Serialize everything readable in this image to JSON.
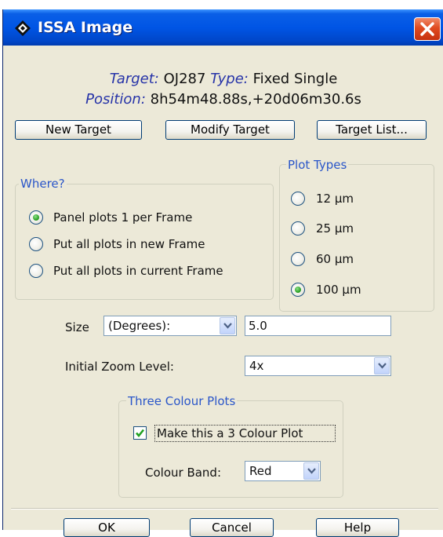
{
  "window": {
    "title": "ISSA Image",
    "icon": "diamond-app-icon",
    "close_icon": "close-icon"
  },
  "target": {
    "target_label": "Target:",
    "target_value": "OJ287",
    "type_label": "Type:",
    "type_value": "Fixed Single",
    "position_label": "Position:",
    "position_value": "8h54m48.88s,+20d06m30.6s"
  },
  "buttons": {
    "new_target": "New Target",
    "modify_target": "Modify Target",
    "target_list": "Target List...",
    "ok": "OK",
    "cancel": "Cancel",
    "help": "Help"
  },
  "where": {
    "title": "Where?",
    "options": [
      {
        "label": "Panel plots 1 per Frame",
        "selected": true
      },
      {
        "label": "Put all plots in new Frame",
        "selected": false
      },
      {
        "label": "Put all plots in current Frame",
        "selected": false
      }
    ]
  },
  "plot_types": {
    "title": "Plot Types",
    "options": [
      {
        "label": "12 µm",
        "selected": false
      },
      {
        "label": "25 µm",
        "selected": false
      },
      {
        "label": "60 µm",
        "selected": false
      },
      {
        "label": "100 µm",
        "selected": true
      }
    ]
  },
  "size": {
    "label": "Size",
    "unit_selected": "(Degrees):",
    "value": "5.0"
  },
  "zoom": {
    "label": "Initial Zoom Level:",
    "selected": "4x"
  },
  "three_colour": {
    "title": "Three Colour Plots",
    "checkbox_label": "Make this a 3 Colour Plot",
    "checked": true,
    "band_label": "Colour Band:",
    "band_selected": "Red"
  },
  "colors": {
    "titlebar": "#0055e5",
    "dialog_bg": "#ece9d8",
    "label_blue": "#2633a8",
    "legend_blue": "#2a56c9",
    "radio_green": "#2ea428",
    "close_red": "#e04a1f"
  }
}
